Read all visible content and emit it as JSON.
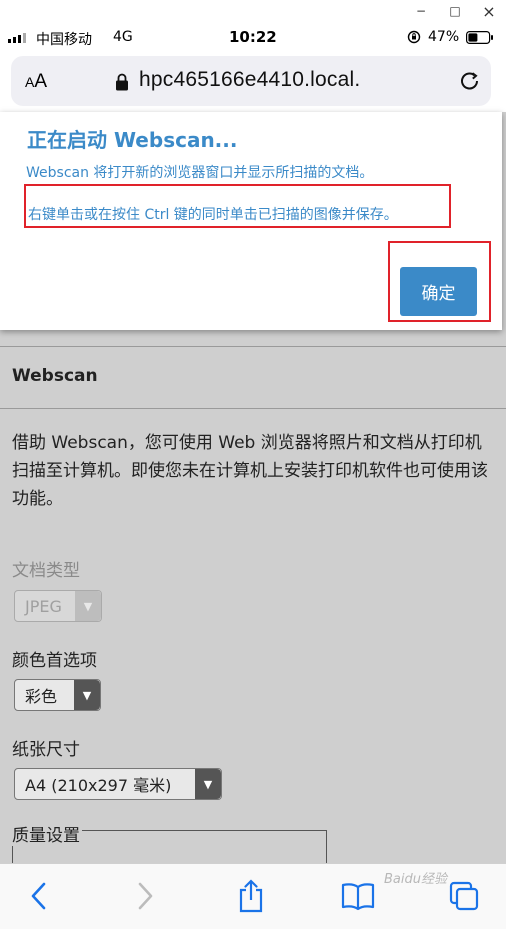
{
  "window": {
    "minimize_glyph": "−",
    "maximize_glyph": "□",
    "close_glyph": "×"
  },
  "status_bar": {
    "carrier": "中国移动",
    "network": "4G",
    "time": "10:22",
    "battery_percent": "47%",
    "battery_level": 0.47
  },
  "address_bar": {
    "text_size_label_small": "A",
    "text_size_label_large": "A",
    "url": "hpc465166e4410.local."
  },
  "dialog": {
    "title": "正在启动 Webscan...",
    "line1": "Webscan 将打开新的浏览器窗口并显示所扫描的文档。",
    "line2": "右键单击或在按住 Ctrl 键的同时单击已扫描的图像并保存。",
    "ok_label": "确定",
    "accent_color": "#3b8ac8",
    "highlight_color": "#e0222a"
  },
  "page": {
    "section_title": "Webscan",
    "description": "借助 Webscan，您可使用 Web 浏览器将照片和文档从打印机扫描至计算机。即使您未在计算机上安装打印机软件也可使用该功能。",
    "doc_type_label": "文档类型",
    "doc_type_value": "JPEG",
    "color_label": "颜色首选项",
    "color_value": "彩色",
    "paper_label": "纸张尺寸",
    "paper_value": "A4 (210x297 毫米)",
    "quality_label": "质量设置"
  },
  "toolbar": {
    "icons": [
      "back-icon",
      "forward-icon",
      "share-icon",
      "bookmarks-icon",
      "tabs-icon"
    ]
  },
  "watermark": "Baidu经验"
}
